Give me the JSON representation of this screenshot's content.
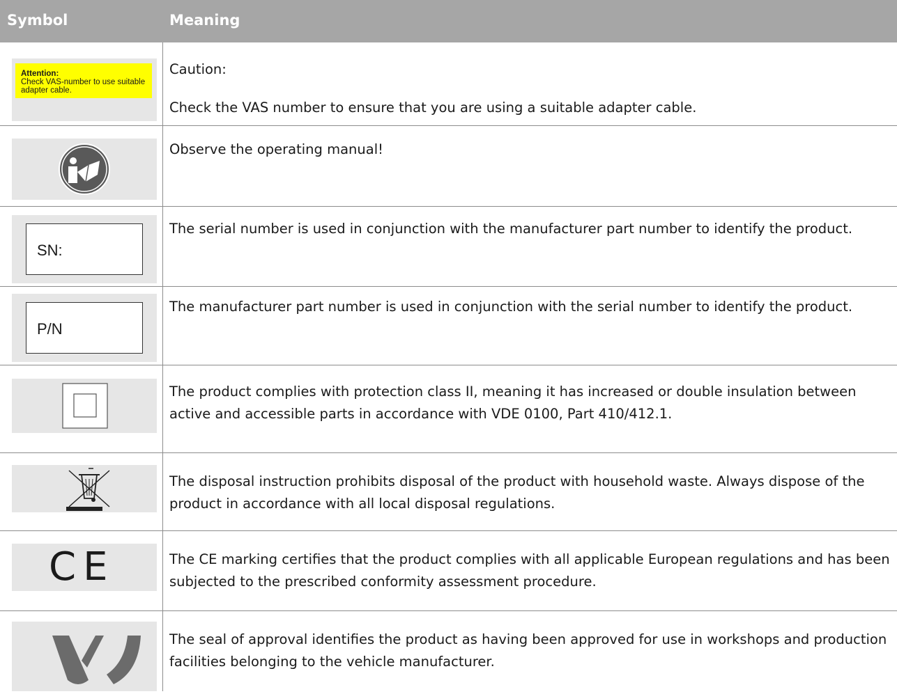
{
  "header": {
    "symbol": "Symbol",
    "meaning": "Meaning"
  },
  "rows": [
    {
      "symbol": {
        "title": "Attention:",
        "text": "Check VAS-number to use suitable adapter cable."
      },
      "meaning": [
        "Caution:",
        "Check the VAS number to ensure that you are using a suitable adapter cable."
      ]
    },
    {
      "symbol": {
        "icon": "operating-manual-icon"
      },
      "meaning": [
        "Observe the operating manual!"
      ]
    },
    {
      "symbol": {
        "text": "SN:"
      },
      "meaning": [
        "The serial number is used in conjunction with the manufacturer part number to identify the product."
      ]
    },
    {
      "symbol": {
        "text": "P/N"
      },
      "meaning": [
        "The manufacturer part number is used in conjunction with the serial number to identify the product."
      ]
    },
    {
      "symbol": {
        "icon": "protection-class-ii-icon"
      },
      "meaning": [
        "The product complies with protection class II, meaning it has increased or double insulation between active and accessible parts in accordance with VDE 0100, Part 410/412.1."
      ]
    },
    {
      "symbol": {
        "icon": "crossed-out-bin-icon"
      },
      "meaning": [
        "The disposal instruction prohibits disposal of the product with household waste. Always dispose of the product in accordance with all local disposal regulations."
      ]
    },
    {
      "symbol": {
        "text": "CE"
      },
      "meaning": [
        "The CE marking certifies that the product complies with all applicable European regulations and has been subjected to the prescribed conformity assessment procedure."
      ]
    },
    {
      "symbol": {
        "icon": "seal-of-approval-icon"
      },
      "meaning": [
        "The seal of approval identifies the product as having been approved for use in workshops and production facilities belonging to the vehicle manufacturer."
      ]
    }
  ]
}
